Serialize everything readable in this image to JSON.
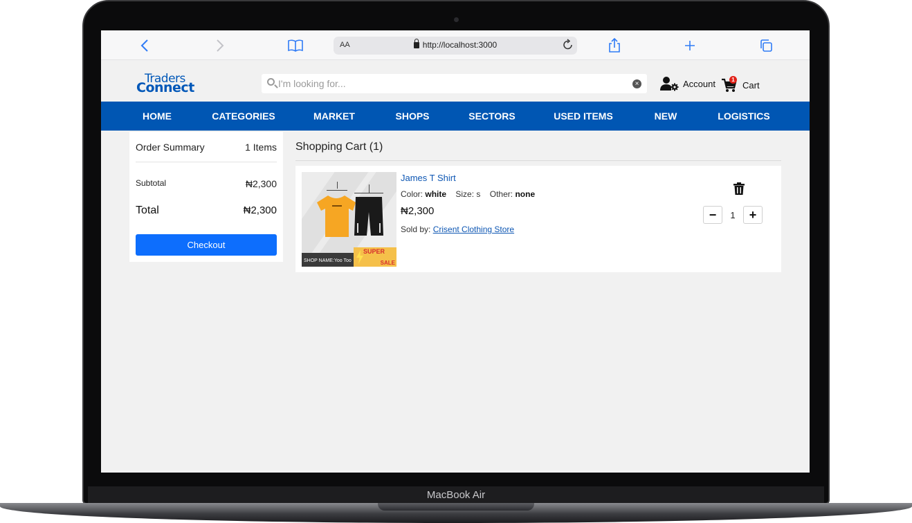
{
  "device": {
    "model_label": "MacBook Air"
  },
  "browser": {
    "aa_label": "AA",
    "url": "http://localhost:3000"
  },
  "header": {
    "logo_line1": "Traders",
    "logo_line2": "Connect",
    "search_placeholder": "I'm looking for...",
    "account_label": "Account",
    "cart_label": "Cart",
    "cart_count": "1"
  },
  "nav": {
    "items": [
      "HOME",
      "CATEGORIES",
      "MARKET",
      "SHOPS",
      "SECTORS",
      "USED ITEMS",
      "NEW",
      "LOGISTICS"
    ]
  },
  "summary": {
    "title": "Order Summary",
    "items_count": "1 Items",
    "subtotal_label": "Subtotal",
    "subtotal_value": "₦2,300",
    "total_label": "Total",
    "total_value": "₦2,300",
    "checkout_label": "Checkout"
  },
  "cart": {
    "title": "Shopping Cart (1)",
    "items": [
      {
        "name": "James T Shirt",
        "color_label": "Color:",
        "color_value": "white",
        "size_label": "Size:",
        "size_value": "s",
        "other_label": "Other:",
        "other_value": "none",
        "price": "₦2,300",
        "sold_by_label": "Sold by:",
        "seller": "Crisent Clothing Store",
        "quantity": "1",
        "image_shop_name": "SHOP NAME:Yoo Too",
        "image_sale_line1": "SUPER",
        "image_sale_line2": "SALE"
      }
    ]
  },
  "colors": {
    "nav_bg": "#0056b3",
    "link": "#0d56b3",
    "checkout_bg": "#0d6efd",
    "badge": "#e2231a"
  }
}
